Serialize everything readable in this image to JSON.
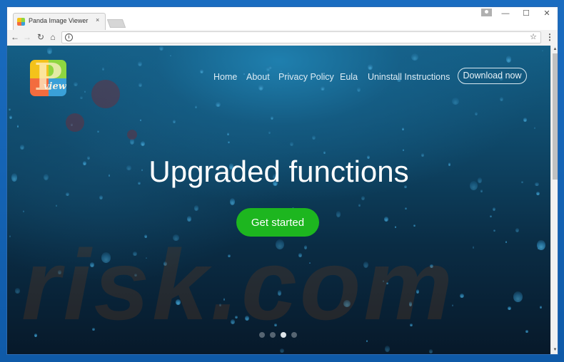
{
  "browser": {
    "tab_title": "Panda Image Viewer",
    "tab_close_glyph": "×",
    "url": "",
    "controls": {
      "minimize": "—",
      "maximize": "☐",
      "close": "✕"
    },
    "nav": {
      "back": "←",
      "forward": "→",
      "reload": "↻",
      "home": "⌂"
    },
    "info_glyph": "i",
    "bookmark_glyph": "☆",
    "menu_glyph": "⋮"
  },
  "site": {
    "logo": {
      "letter": "P",
      "word": "view",
      "colors": [
        "#f4c21b",
        "#8ed640",
        "#f36c3e",
        "#3aa0d8"
      ]
    },
    "nav_links": [
      "Home",
      "About",
      "Privacy Policy",
      "Eula",
      "Uninstall Instructions"
    ],
    "download_label": "Download now",
    "hero_title": "Upgraded functions",
    "cta_label": "Get started",
    "cta_color": "#1db61f",
    "carousel": {
      "count": 4,
      "active_index": 2
    },
    "watermark": "risk.com"
  },
  "scrollbar": {
    "up_glyph": "▲",
    "down_glyph": "▼",
    "thumb_fraction": 0.43
  }
}
